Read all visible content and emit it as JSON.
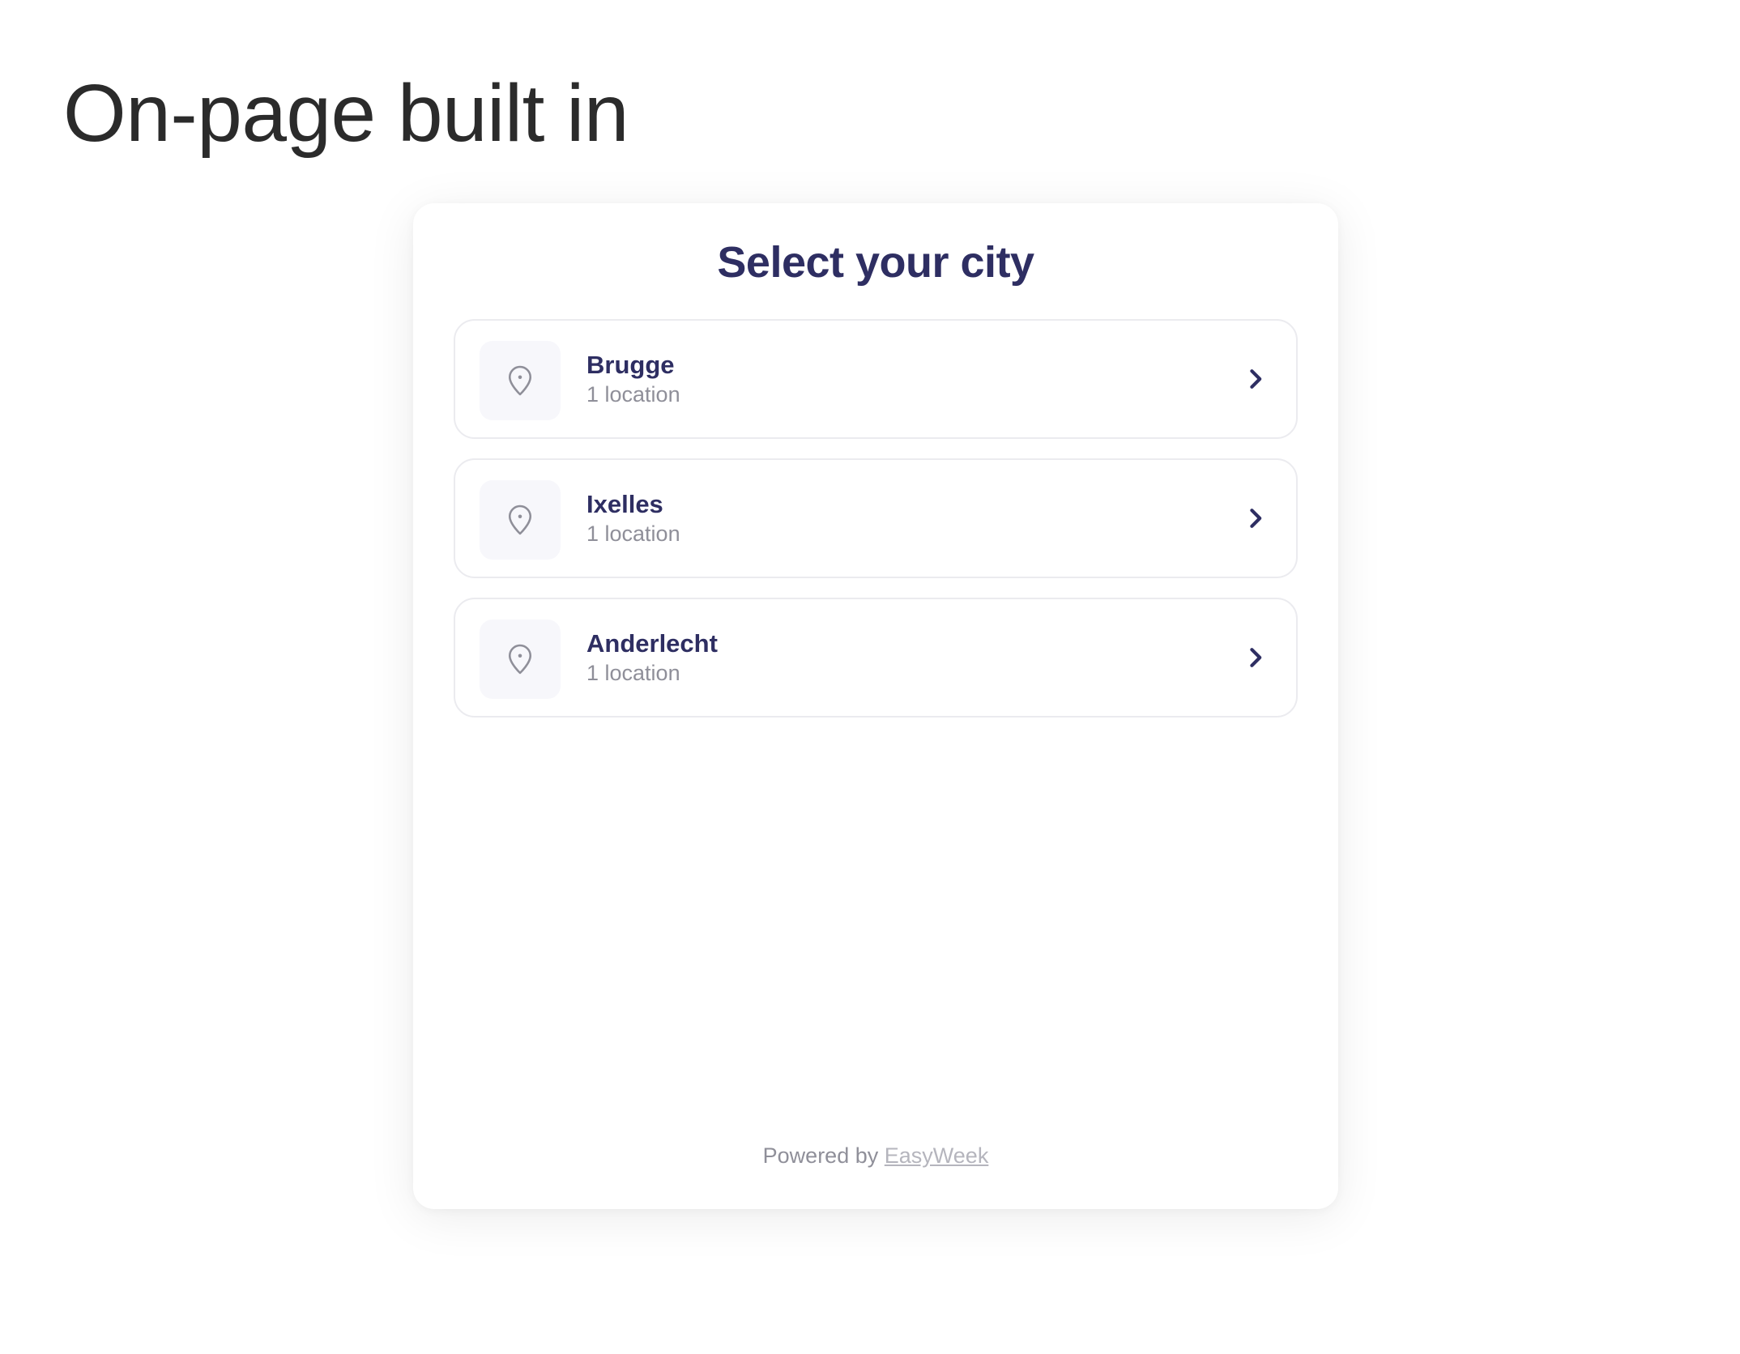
{
  "page": {
    "heading": "On-page built in"
  },
  "widget": {
    "title": "Select your city",
    "cities": [
      {
        "name": "Brugge",
        "count": "1 location"
      },
      {
        "name": "Ixelles",
        "count": "1 location"
      },
      {
        "name": "Anderlecht",
        "count": "1 location"
      }
    ],
    "footer": {
      "powered_prefix": "Powered by",
      "powered_link": "EasyWeek"
    }
  },
  "icons": {
    "city_icon": "map-pin-icon",
    "chevron": "chevron-right-icon"
  },
  "colors": {
    "title": "#2e2e62",
    "muted": "#8f8f99",
    "border": "#ebebef",
    "icon_bg": "#f7f7fb"
  }
}
